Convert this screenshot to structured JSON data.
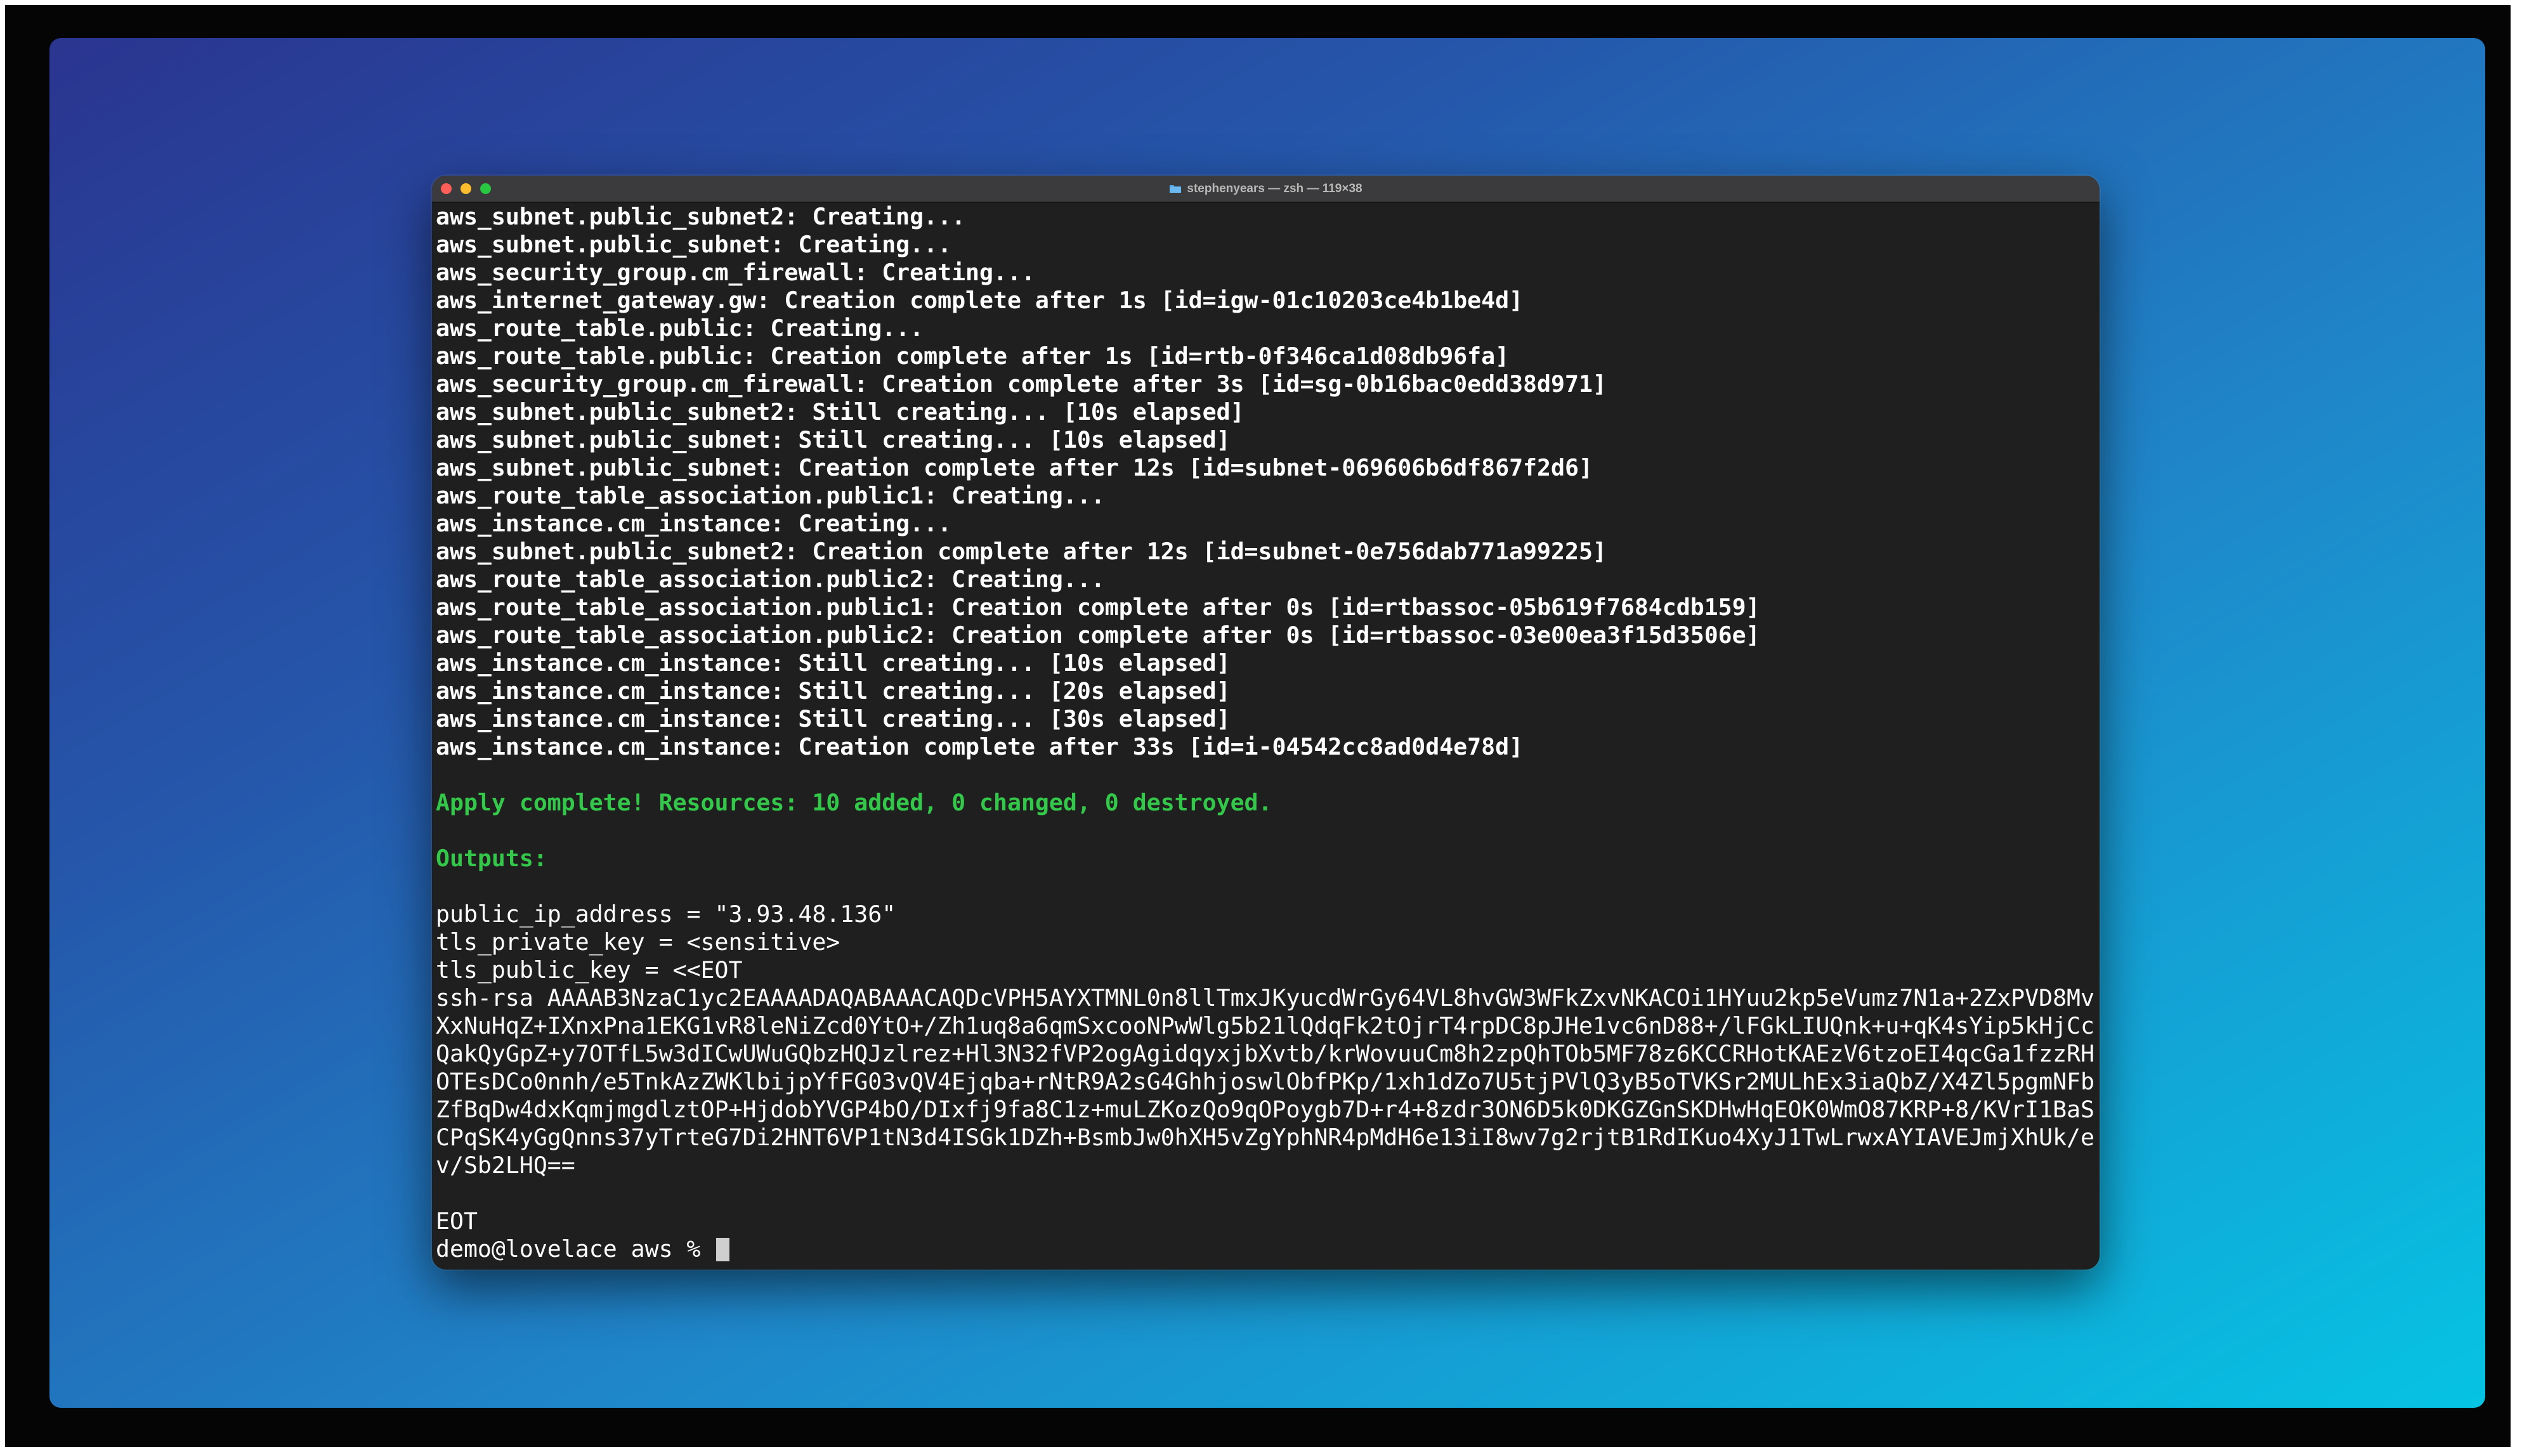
{
  "window": {
    "title": "stephenyears — zsh — 119×38"
  },
  "terminal": {
    "log_lines": [
      "aws_subnet.public_subnet2: Creating...",
      "aws_subnet.public_subnet: Creating...",
      "aws_security_group.cm_firewall: Creating...",
      "aws_internet_gateway.gw: Creation complete after 1s [id=igw-01c10203ce4b1be4d]",
      "aws_route_table.public: Creating...",
      "aws_route_table.public: Creation complete after 1s [id=rtb-0f346ca1d08db96fa]",
      "aws_security_group.cm_firewall: Creation complete after 3s [id=sg-0b16bac0edd38d971]",
      "aws_subnet.public_subnet2: Still creating... [10s elapsed]",
      "aws_subnet.public_subnet: Still creating... [10s elapsed]",
      "aws_subnet.public_subnet: Creation complete after 12s [id=subnet-069606b6df867f2d6]",
      "aws_route_table_association.public1: Creating...",
      "aws_instance.cm_instance: Creating...",
      "aws_subnet.public_subnet2: Creation complete after 12s [id=subnet-0e756dab771a99225]",
      "aws_route_table_association.public2: Creating...",
      "aws_route_table_association.public1: Creation complete after 0s [id=rtbassoc-05b619f7684cdb159]",
      "aws_route_table_association.public2: Creation complete after 0s [id=rtbassoc-03e00ea3f15d3506e]",
      "aws_instance.cm_instance: Still creating... [10s elapsed]",
      "aws_instance.cm_instance: Still creating... [20s elapsed]",
      "aws_instance.cm_instance: Still creating... [30s elapsed]",
      "aws_instance.cm_instance: Creation complete after 33s [id=i-04542cc8ad0d4e78d]"
    ],
    "apply_complete": "Apply complete! Resources: 10 added, 0 changed, 0 destroyed.",
    "outputs_header": "Outputs:",
    "output_lines": [
      "public_ip_address = \"3.93.48.136\"",
      "tls_private_key = <sensitive>",
      "tls_public_key = <<EOT",
      "ssh-rsa AAAAB3NzaC1yc2EAAAADAQABAAACAQDcVPH5AYXTMNL0n8llTmxJKyucdWrGy64VL8hvGW3WFkZxvNKACOi1HYuu2kp5eVumz7N1a+2ZxPVD8Mv",
      "XxNuHqZ+IXnxPna1EKG1vR8leNiZcd0YtO+/Zh1uq8a6qmSxcooNPwWlg5b21lQdqFk2tOjrT4rpDC8pJHe1vc6nD88+/lFGkLIUQnk+u+qK4sYip5kHjCc",
      "QakQyGpZ+y7OTfL5w3dICwUWuGQbzHQJzlrez+Hl3N32fVP2ogAgidqyxjbXvtb/krWovuuCm8h2zpQhTOb5MF78z6KCCRHotKAEzV6tzoEI4qcGa1fzzRH",
      "OTEsDCo0nnh/e5TnkAzZWKlbijpYfFG03vQV4Ejqba+rNtR9A2sG4GhhjoswlObfPKp/1xh1dZo7U5tjPVlQ3yB5oTVKSr2MULhEx3iaQbZ/X4Zl5pgmNFb",
      "ZfBqDw4dxKqmjmgdlztOP+HjdobYVGP4bO/DIxfj9fa8C1z+muLZKozQo9qOPoygb7D+r4+8zdr3ON6D5k0DKGZGnSKDHwHqEOK0WmO87KRP+8/KVrI1BaS",
      "CPqSK4yGgQnns37yTrteG7Di2HNT6VP1tN3d4ISGk1DZh+BsmbJw0hXH5vZgYphNR4pMdH6e13iI8wv7g2rjtB1RdIKuo4XyJ1TwLrwxAYIAVEJmjXhUk/e",
      "v/Sb2LHQ=="
    ],
    "eot": "EOT",
    "prompt": "demo@lovelace aws % "
  }
}
